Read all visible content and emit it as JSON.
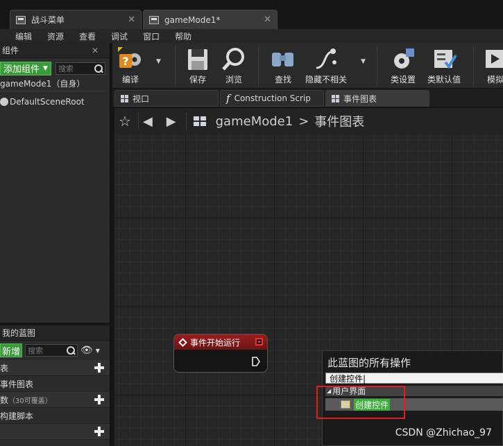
{
  "doc_tabs": [
    {
      "label": "战斗菜单",
      "active": false
    },
    {
      "label": "gameMode1*",
      "active": true
    }
  ],
  "menu": [
    "编辑",
    "资源",
    "查看",
    "调试",
    "窗口",
    "帮助"
  ],
  "components_panel": {
    "title": "组件",
    "add_button": "添加组件",
    "search_placeholder": "搜索",
    "self_item": "gameMode1（自身）",
    "root_item": "DefaultSceneRoot"
  },
  "toolbar": {
    "compile": "编译",
    "save": "保存",
    "browse": "浏览",
    "find": "查找",
    "hide_unrelated": "隐藏不相关",
    "class_settings": "类设置",
    "class_defaults": "类默认值",
    "simulate": "模拟"
  },
  "editor_tabs": [
    {
      "label": "视口",
      "active": false
    },
    {
      "label": "Construction Scrip",
      "active": false
    },
    {
      "label": "事件图表",
      "active": true
    }
  ],
  "breadcrumb": {
    "blueprint": "gameMode1",
    "separator": ">",
    "graph": "事件图表"
  },
  "my_blueprint": {
    "title": "我的蓝图",
    "new_button": "新增",
    "search_placeholder": "搜索",
    "rows": [
      {
        "label": "表"
      },
      {
        "label": "事件图表"
      },
      {
        "label": "数",
        "note": "（30可覆盖）"
      },
      {
        "label": "构建脚本"
      }
    ]
  },
  "event_node": {
    "title": "事件开始运行"
  },
  "context_menu": {
    "title": "此蓝图的所有操作",
    "search_value": "创建控件",
    "category": "用户界面",
    "item": "创建控件"
  },
  "watermark": "CSDN @Zhichao_97",
  "colors": {
    "accent_green": "#3db13d",
    "event_red": "#9b1e1e",
    "highlight_box": "#e02020"
  }
}
